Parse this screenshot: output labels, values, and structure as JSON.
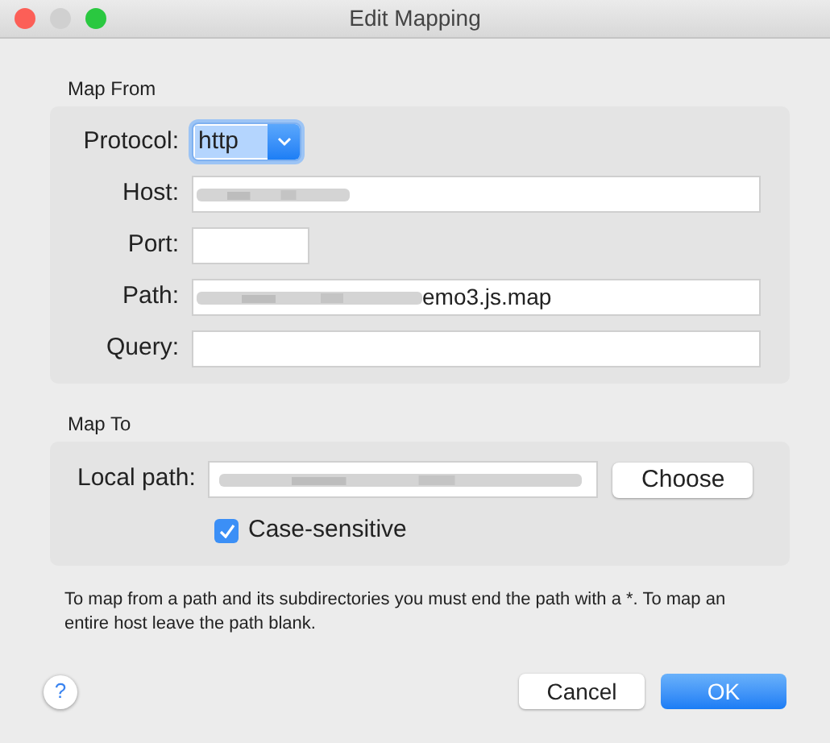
{
  "window": {
    "title": "Edit Mapping"
  },
  "map_from": {
    "title": "Map From",
    "protocol": {
      "label": "Protocol:",
      "value": "http"
    },
    "fields": [
      {
        "label": "Host:",
        "redacted": true,
        "kind": "wide"
      },
      {
        "label": "Port:",
        "redacted": false,
        "kind": "short"
      },
      {
        "label": "Path:",
        "value": "emo3.js.map",
        "redacted": true,
        "kind": "wide"
      },
      {
        "label": "Query:",
        "redacted": false,
        "kind": "wide"
      }
    ]
  },
  "map_to": {
    "title": "Map To",
    "local_path": {
      "label": "Local path:",
      "redacted": true
    },
    "choose_button": "Choose",
    "case_sensitive": {
      "label": "Case-sensitive",
      "checked": true
    }
  },
  "note": "To map from a path and its subdirectories you must end the path with a *. To map an entire host leave the path blank.",
  "help_button": "?",
  "buttons": [
    {
      "label": "Cancel",
      "default": false
    },
    {
      "label": "OK",
      "default": true
    }
  ]
}
